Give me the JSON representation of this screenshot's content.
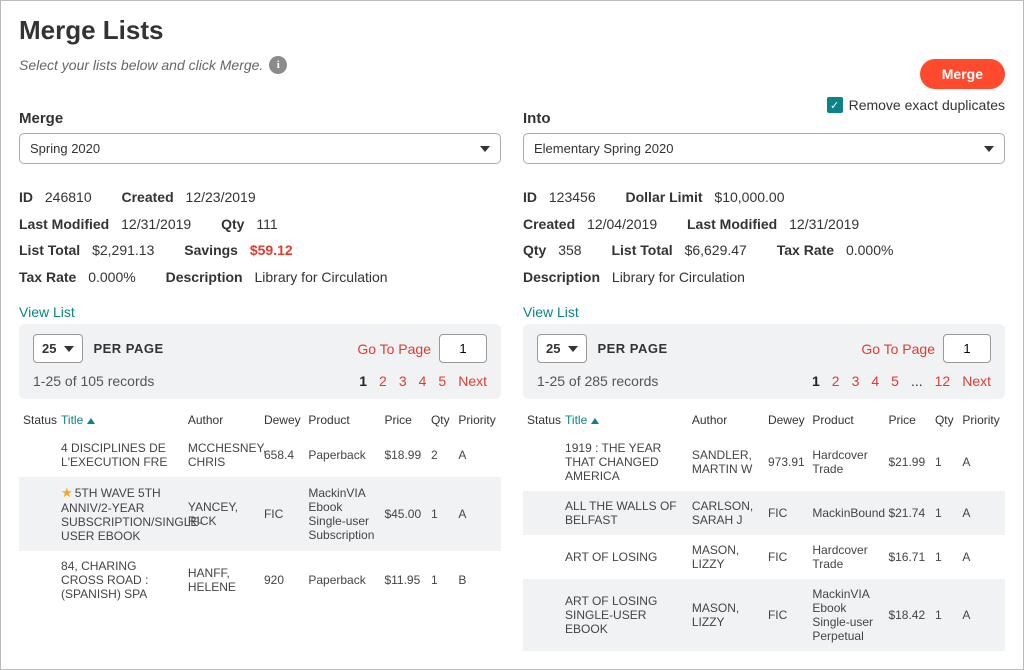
{
  "header": {
    "title": "Merge Lists",
    "subtitle": "Select your lists below and click Merge.",
    "info_icon_glyph": "i"
  },
  "actions": {
    "merge_button": "Merge",
    "remove_dup_label": "Remove exact duplicates",
    "remove_dup_checked": true
  },
  "left": {
    "field_label": "Merge",
    "select_value": "Spring 2020",
    "meta": {
      "id_label": "ID",
      "id": "246810",
      "created_label": "Created",
      "created": "12/23/2019",
      "modified_label": "Last Modified",
      "modified": "12/31/2019",
      "qty_label": "Qty",
      "qty": "111",
      "total_label": "List Total",
      "total": "$2,291.13",
      "savings_label": "Savings",
      "savings": "$59.12",
      "tax_label": "Tax Rate",
      "tax": "0.000%",
      "desc_label": "Description",
      "desc": "Library for Circulation"
    },
    "view_link": "View List",
    "pager": {
      "per_page_value": "25",
      "per_page_label": "PER PAGE",
      "goto_label": "Go To Page",
      "goto_value": "1",
      "record_text": "1-25 of 105 records",
      "pages": [
        "1",
        "2",
        "3",
        "4",
        "5"
      ],
      "current_page": "1",
      "next_label": "Next"
    },
    "columns": {
      "status": "Status",
      "title": "Title",
      "author": "Author",
      "dewey": "Dewey",
      "product": "Product",
      "price": "Price",
      "qty": "Qty",
      "priority": "Priority"
    },
    "rows": [
      {
        "title": "4 DISCIPLINES DE L'EXECUTION FRE",
        "author": "MCCHESNEY, CHRIS",
        "dewey": "658.4",
        "product": "Paperback",
        "price": "$18.99",
        "qty": "2",
        "priority": "A",
        "star": false
      },
      {
        "title": "5TH WAVE 5TH ANNIV/2-YEAR SUBSCRIPTION/SINGLE-USER EBOOK",
        "author": "YANCEY, RICK",
        "dewey": "FIC",
        "product": "MackinVIA Ebook Single-user Subscription",
        "price": "$45.00",
        "qty": "1",
        "priority": "A",
        "star": true
      },
      {
        "title": "84, CHARING CROSS ROAD : (SPANISH) SPA",
        "author": "HANFF, HELENE",
        "dewey": "920",
        "product": "Paperback",
        "price": "$11.95",
        "qty": "1",
        "priority": "B",
        "star": false
      }
    ]
  },
  "right": {
    "field_label": "Into",
    "select_value": "Elementary Spring 2020",
    "meta": {
      "id_label": "ID",
      "id": "123456",
      "limit_label": "Dollar Limit",
      "limit": "$10,000.00",
      "created_label": "Created",
      "created": "12/04/2019",
      "modified_label": "Last Modified",
      "modified": "12/31/2019",
      "qty_label": "Qty",
      "qty": "358",
      "total_label": "List Total",
      "total": "$6,629.47",
      "tax_label": "Tax Rate",
      "tax": "0.000%",
      "desc_label": "Description",
      "desc": "Library for Circulation"
    },
    "view_link": "View List",
    "pager": {
      "per_page_value": "25",
      "per_page_label": "PER PAGE",
      "goto_label": "Go To Page",
      "goto_value": "1",
      "record_text": "1-25 of 285 records",
      "pages": [
        "1",
        "2",
        "3",
        "4",
        "5",
        "...",
        "12"
      ],
      "current_page": "1",
      "next_label": "Next"
    },
    "columns": {
      "status": "Status",
      "title": "Title",
      "author": "Author",
      "dewey": "Dewey",
      "product": "Product",
      "price": "Price",
      "qty": "Qty",
      "priority": "Priority"
    },
    "rows": [
      {
        "title": "1919 : THE YEAR THAT CHANGED AMERICA",
        "author": "SANDLER, MARTIN W",
        "dewey": "973.91",
        "product": "Hardcover Trade",
        "price": "$21.99",
        "qty": "1",
        "priority": "A"
      },
      {
        "title": "ALL THE WALLS OF BELFAST",
        "author": "CARLSON, SARAH J",
        "dewey": "FIC",
        "product": "MackinBound",
        "price": "$21.74",
        "qty": "1",
        "priority": "A"
      },
      {
        "title": "ART OF LOSING",
        "author": "MASON, LIZZY",
        "dewey": "FIC",
        "product": "Hardcover Trade",
        "price": "$16.71",
        "qty": "1",
        "priority": "A"
      },
      {
        "title": "ART OF LOSING SINGLE-USER EBOOK",
        "author": "MASON, LIZZY",
        "dewey": "FIC",
        "product": "MackinVIA Ebook Single-user Perpetual",
        "price": "$18.42",
        "qty": "1",
        "priority": "A"
      }
    ]
  }
}
